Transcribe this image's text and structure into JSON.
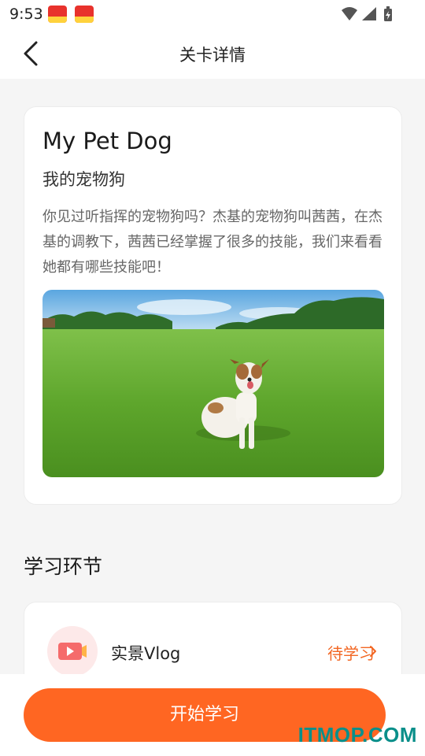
{
  "status_bar": {
    "time": "9:53",
    "notification_icons": [
      "app-badge-icon",
      "app-badge-icon"
    ],
    "right_icons": [
      "wifi-icon",
      "signal-icon",
      "battery-icon"
    ]
  },
  "header": {
    "title": "关卡详情",
    "back_icon": "chevron-left-icon"
  },
  "lesson": {
    "title_en": "My Pet Dog",
    "title_cn": "我的宠物狗",
    "description": "你见过听指挥的宠物狗吗？杰基的宠物狗叫茜茜，在杰基的调教下，茜茜已经掌握了很多的技能，我们来看看她都有哪些技能吧！",
    "image": "dog-sitting-on-grass-photo"
  },
  "section": {
    "heading": "学习环节"
  },
  "steps": [
    {
      "icon": "video-play-icon",
      "label": "实景Vlog",
      "status": "待学习"
    }
  ],
  "actions": {
    "start_label": "开始学习"
  },
  "watermark": "ITMOP.COM",
  "colors": {
    "accent": "#ff6622",
    "status_text": "#f26622",
    "watermark": "#0a8f8a"
  }
}
